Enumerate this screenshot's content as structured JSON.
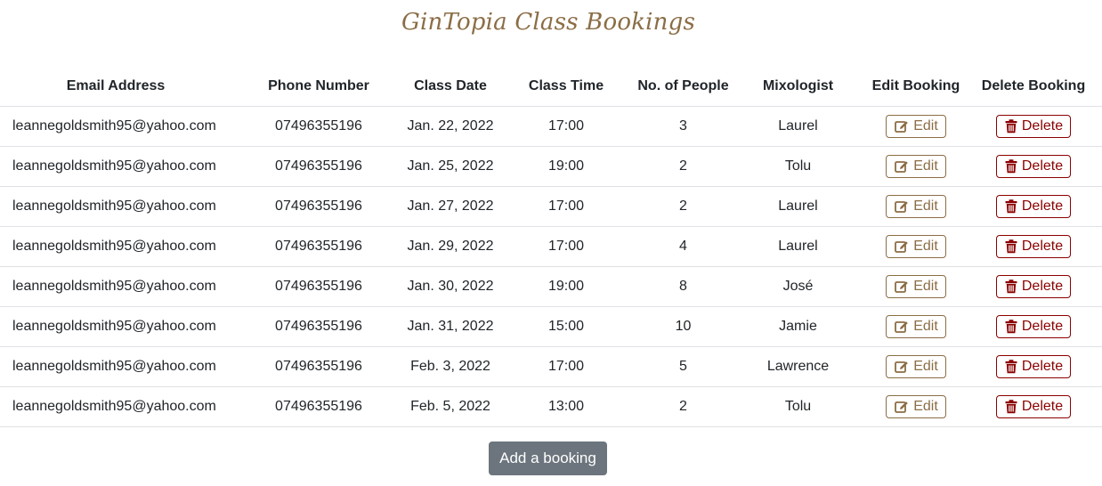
{
  "page": {
    "title": "GinTopia Class Bookings"
  },
  "table": {
    "headers": [
      "Email Address",
      "Phone Number",
      "Class Date",
      "Class Time",
      "No. of People",
      "Mixologist",
      "Edit Booking",
      "Delete Booking"
    ],
    "rows": [
      {
        "email": "leannegoldsmith95@yahoo.com",
        "phone": "07496355196",
        "date": "Jan. 22, 2022",
        "time": "17:00",
        "people": "3",
        "mixologist": "Laurel"
      },
      {
        "email": "leannegoldsmith95@yahoo.com",
        "phone": "07496355196",
        "date": "Jan. 25, 2022",
        "time": "19:00",
        "people": "2",
        "mixologist": "Tolu"
      },
      {
        "email": "leannegoldsmith95@yahoo.com",
        "phone": "07496355196",
        "date": "Jan. 27, 2022",
        "time": "17:00",
        "people": "2",
        "mixologist": "Laurel"
      },
      {
        "email": "leannegoldsmith95@yahoo.com",
        "phone": "07496355196",
        "date": "Jan. 29, 2022",
        "time": "17:00",
        "people": "4",
        "mixologist": "Laurel"
      },
      {
        "email": "leannegoldsmith95@yahoo.com",
        "phone": "07496355196",
        "date": "Jan. 30, 2022",
        "time": "19:00",
        "people": "8",
        "mixologist": "José"
      },
      {
        "email": "leannegoldsmith95@yahoo.com",
        "phone": "07496355196",
        "date": "Jan. 31, 2022",
        "time": "15:00",
        "people": "10",
        "mixologist": "Jamie"
      },
      {
        "email": "leannegoldsmith95@yahoo.com",
        "phone": "07496355196",
        "date": "Feb. 3, 2022",
        "time": "17:00",
        "people": "5",
        "mixologist": "Lawrence"
      },
      {
        "email": "leannegoldsmith95@yahoo.com",
        "phone": "07496355196",
        "date": "Feb. 5, 2022",
        "time": "13:00",
        "people": "2",
        "mixologist": "Tolu"
      }
    ],
    "edit_label": "Edit",
    "delete_label": "Delete",
    "edit_icon": "pen-square-icon",
    "delete_icon": "trash-icon"
  },
  "actions": {
    "add_label": "Add a booking"
  },
  "colors": {
    "brand": "#8b6d45",
    "danger": "#8b0000",
    "secondary": "#6c757d",
    "border": "#dee2e6",
    "text": "#212529"
  }
}
